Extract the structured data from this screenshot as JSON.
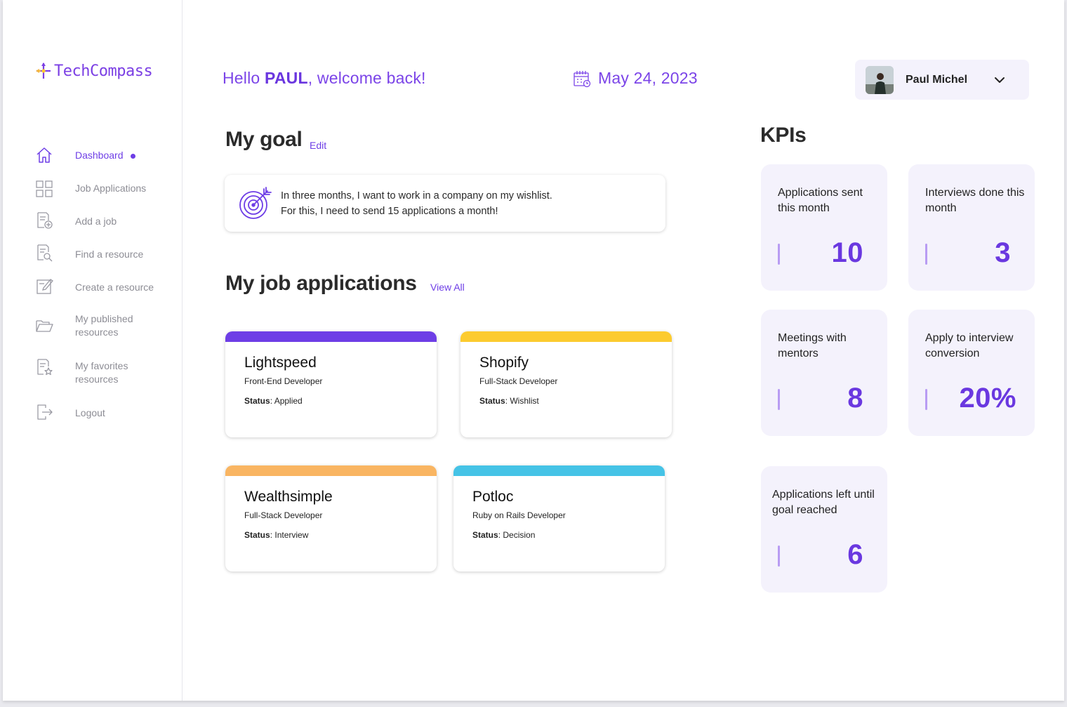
{
  "brand": {
    "name": "TechCompass"
  },
  "sidebar": {
    "items": [
      {
        "label": "Dashboard",
        "icon": "home-icon",
        "active": true
      },
      {
        "label": "Job Applications",
        "icon": "grid-icon"
      },
      {
        "label": "Add a job",
        "icon": "add-document-icon"
      },
      {
        "label": "Find a resource",
        "icon": "search-document-icon"
      },
      {
        "label": "Create a resource",
        "icon": "edit-icon"
      },
      {
        "label": "My published resources",
        "icon": "folder-icon"
      },
      {
        "label": "My favorites resources",
        "icon": "star-document-icon"
      },
      {
        "label": "Logout",
        "icon": "logout-icon"
      }
    ]
  },
  "header": {
    "greeting_prefix": "Hello ",
    "user_first": "PAUL",
    "greeting_suffix": ", welcome back!",
    "date": "May 24,  2023",
    "user_name": "Paul Michel"
  },
  "goal": {
    "title": "My goal",
    "edit_label": "Edit",
    "line1": "In three months, I want to work in a company on my wishlist.",
    "line2": "For this, I need to send 15 applications a month!"
  },
  "applications": {
    "title": "My job applications",
    "view_all_label": "View All",
    "status_label": "Status",
    "cards": [
      {
        "company": "Lightspeed",
        "role": "Front-End Developer",
        "status": "Applied",
        "color": "#6e3ee6"
      },
      {
        "company": "Shopify",
        "role": "Full-Stack Developer",
        "status": "Wishlist",
        "color": "#fccb2f"
      },
      {
        "company": "Wealthsimple",
        "role": "Full-Stack Developer",
        "status": "Interview",
        "color": "#f9b562"
      },
      {
        "company": "Potloc",
        "role": "Ruby on Rails Developer",
        "status": "Decision",
        "color": "#45c3e6"
      }
    ]
  },
  "kpis": {
    "title": "KPIs",
    "cards": [
      {
        "label": "Applications sent this month",
        "value": "10"
      },
      {
        "label": "Interviews done this month",
        "value": "3"
      },
      {
        "label": "Meetings with mentors",
        "value": "8"
      },
      {
        "label": "Apply to interview conversion",
        "value": "20%"
      },
      {
        "label": "Applications left until goal reached",
        "value": "6"
      }
    ]
  },
  "colors": {
    "accent": "#6e3ee6",
    "kpi_bg": "#f4f2fc"
  }
}
